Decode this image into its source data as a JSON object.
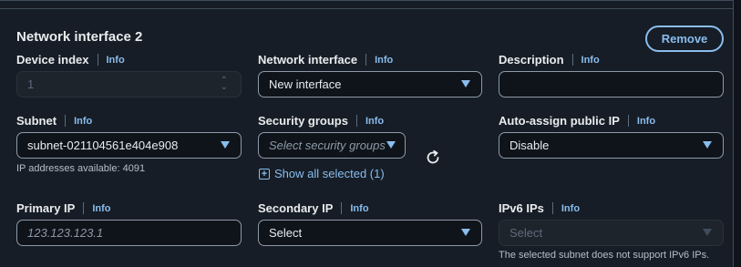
{
  "section": {
    "title": "Network interface 2",
    "remove_label": "Remove"
  },
  "info_label": "Info",
  "device_index": {
    "label": "Device index",
    "value": "1"
  },
  "network_interface": {
    "label": "Network interface",
    "value": "New interface"
  },
  "description": {
    "label": "Description",
    "value": ""
  },
  "subnet": {
    "label": "Subnet",
    "value": "subnet-021104561e404e908",
    "hint": "IP addresses available: 4091"
  },
  "security_groups": {
    "label": "Security groups",
    "placeholder": "Select security groups",
    "show_all": "Show all selected (1)"
  },
  "auto_assign": {
    "label": "Auto-assign public IP",
    "value": "Disable"
  },
  "primary_ip": {
    "label": "Primary IP",
    "placeholder": "123.123.123.1"
  },
  "secondary_ip": {
    "label": "Secondary IP",
    "value": "Select"
  },
  "ipv6": {
    "label": "IPv6 IPs",
    "value": "Select",
    "hint": "The selected subnet does not support IPv6 IPs."
  },
  "icons": {
    "refresh": "refresh-icon",
    "plus": "plus-box-icon",
    "caret": "caret-down-icon",
    "spinner": "spinner-arrows-icon"
  },
  "colors": {
    "accent": "#89bdee",
    "background": "#161d26",
    "text": "#e9ebed"
  }
}
